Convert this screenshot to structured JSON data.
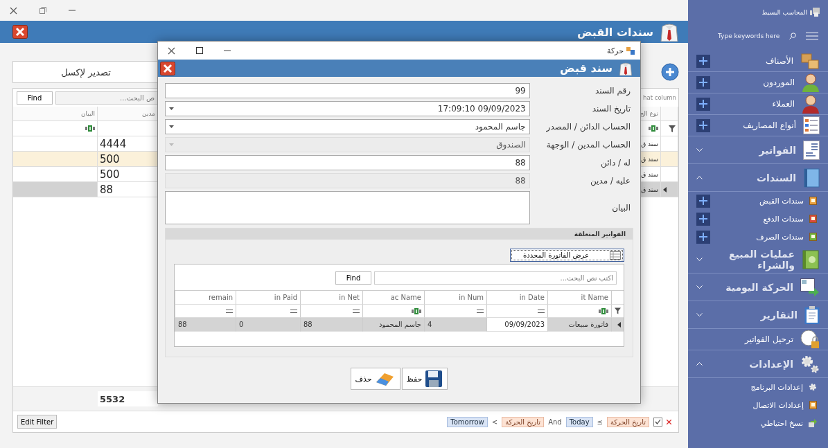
{
  "main_window": {
    "title": "سندات القبض",
    "export_button": "تصدير لإكسل",
    "grid": {
      "find_button": "Find",
      "search_placeholder": "ص البحث...",
      "group_panel_hint": "hat column",
      "columns": [
        {
          "header": "نوع الح",
          "kind": "text"
        },
        {
          "header": "مدين",
          "kind": "number"
        },
        {
          "header": "البيان",
          "kind": "text"
        }
      ],
      "rows": [
        {
          "cells": [
            "سند ق",
            "4444",
            null
          ],
          "highlighted": false,
          "selected": false
        },
        {
          "cells": [
            "سند ق",
            "500",
            null
          ],
          "highlighted": true,
          "selected": false
        },
        {
          "cells": [
            "سند ق",
            "500",
            null
          ],
          "highlighted": false,
          "selected": false
        },
        {
          "cells": [
            "سند ق",
            "88",
            null
          ],
          "highlighted": false,
          "selected": true
        }
      ],
      "footer_total": "5532",
      "edit_filter_button": "Edit Filter",
      "filter": {
        "enabled": true,
        "parts": [
          {
            "kind": "field",
            "text": "تاريخ الحركة"
          },
          {
            "kind": "operator",
            "text": "≤"
          },
          {
            "kind": "value",
            "text": "Today"
          },
          {
            "kind": "operator",
            "text": "And"
          },
          {
            "kind": "field",
            "text": "تاريخ الحركة"
          },
          {
            "kind": "operator",
            "text": "<"
          },
          {
            "kind": "value",
            "text": "Tomorrow"
          }
        ]
      }
    }
  },
  "dialog": {
    "title": "حركة",
    "header": "سند قبض",
    "fields": [
      {
        "label": "رقم السند",
        "value": "99",
        "kind": "text",
        "disabled": false
      },
      {
        "label": "تاريخ السند",
        "value": "17:09:10 09/09/2023",
        "kind": "combo",
        "disabled": false
      },
      {
        "label": "الحساب الدائن / المصدر",
        "value": "جاسم المحمود",
        "kind": "combo",
        "disabled": false
      },
      {
        "label": "الحساب المدين / الوجهة",
        "value": "الصندوق",
        "kind": "combo",
        "disabled": true
      },
      {
        "label": "له / دائن",
        "value": "88",
        "kind": "text",
        "disabled": false
      },
      {
        "label": "عليه / مدين",
        "value": "88",
        "kind": "text",
        "disabled": true
      },
      {
        "label": "البيان",
        "kind": "memo",
        "disabled": false
      }
    ],
    "related": {
      "title": "الفواتير المتعلقة",
      "show_button": "عرض الفاتورة المحددة",
      "find_button": "Find",
      "search_placeholder": "اكتب نص البحث...",
      "columns": [
        {
          "header": "it Name",
          "kind": "text"
        },
        {
          "header": "in Date",
          "kind": "date"
        },
        {
          "header": "in Num",
          "kind": "number"
        },
        {
          "header": "ac Name",
          "kind": "text"
        },
        {
          "header": "in Net",
          "kind": "number"
        },
        {
          "header": "in Paid",
          "kind": "number"
        },
        {
          "header": "remain",
          "kind": "number"
        }
      ],
      "rows": [
        {
          "selected": true,
          "cells": [
            {
              "text": "فاتورة مبيعات",
              "focused": false
            },
            {
              "text": "09/09/2023",
              "focused": true
            },
            {
              "text": "4",
              "focused": false
            },
            {
              "text": "جاسم المحمود",
              "focused": false
            },
            {
              "text": "88",
              "focused": false
            },
            {
              "text": "0",
              "focused": false
            },
            {
              "text": "88",
              "focused": false
            }
          ]
        }
      ]
    },
    "buttons": [
      {
        "kind": "save",
        "label": "حفظ"
      },
      {
        "kind": "delete",
        "label": "حذف"
      }
    ]
  },
  "sidebar": {
    "app_title": "المحاسب البسيط",
    "search_placeholder": "Type keywords here",
    "items": [
      {
        "kind": "item",
        "label": "الأصناف",
        "add_button": true
      },
      {
        "kind": "item",
        "label": "الموردون",
        "add_button": true
      },
      {
        "kind": "item",
        "label": "العملاء",
        "add_button": true
      },
      {
        "kind": "item",
        "label": "أنواع المصاريف",
        "add_button": true
      },
      {
        "kind": "group",
        "label": "الفواتير",
        "expanded": false
      },
      {
        "kind": "group",
        "label": "السندات",
        "expanded": true,
        "children": [
          {
            "label": "سندات القبض",
            "add_button": true
          },
          {
            "label": "سندات الدفع",
            "add_button": true
          },
          {
            "label": "سندات الصرف",
            "add_button": true
          }
        ]
      },
      {
        "kind": "group",
        "label": "عمليات المبيع والشراء",
        "expanded": false
      },
      {
        "kind": "group",
        "label": "الحركة اليومية",
        "expanded": false
      },
      {
        "kind": "group",
        "label": "التقارير",
        "expanded": false
      },
      {
        "kind": "item",
        "label": "ترحيل الفواتير",
        "add_button": false
      },
      {
        "kind": "group",
        "label": "الإعدادات",
        "expanded": true,
        "children": [
          {
            "label": "إعدادات البرنامج",
            "add_button": false
          },
          {
            "label": "إعدادات الاتصال",
            "add_button": false
          },
          {
            "label": "نسخ احتياطي",
            "add_button": false
          }
        ]
      }
    ]
  }
}
